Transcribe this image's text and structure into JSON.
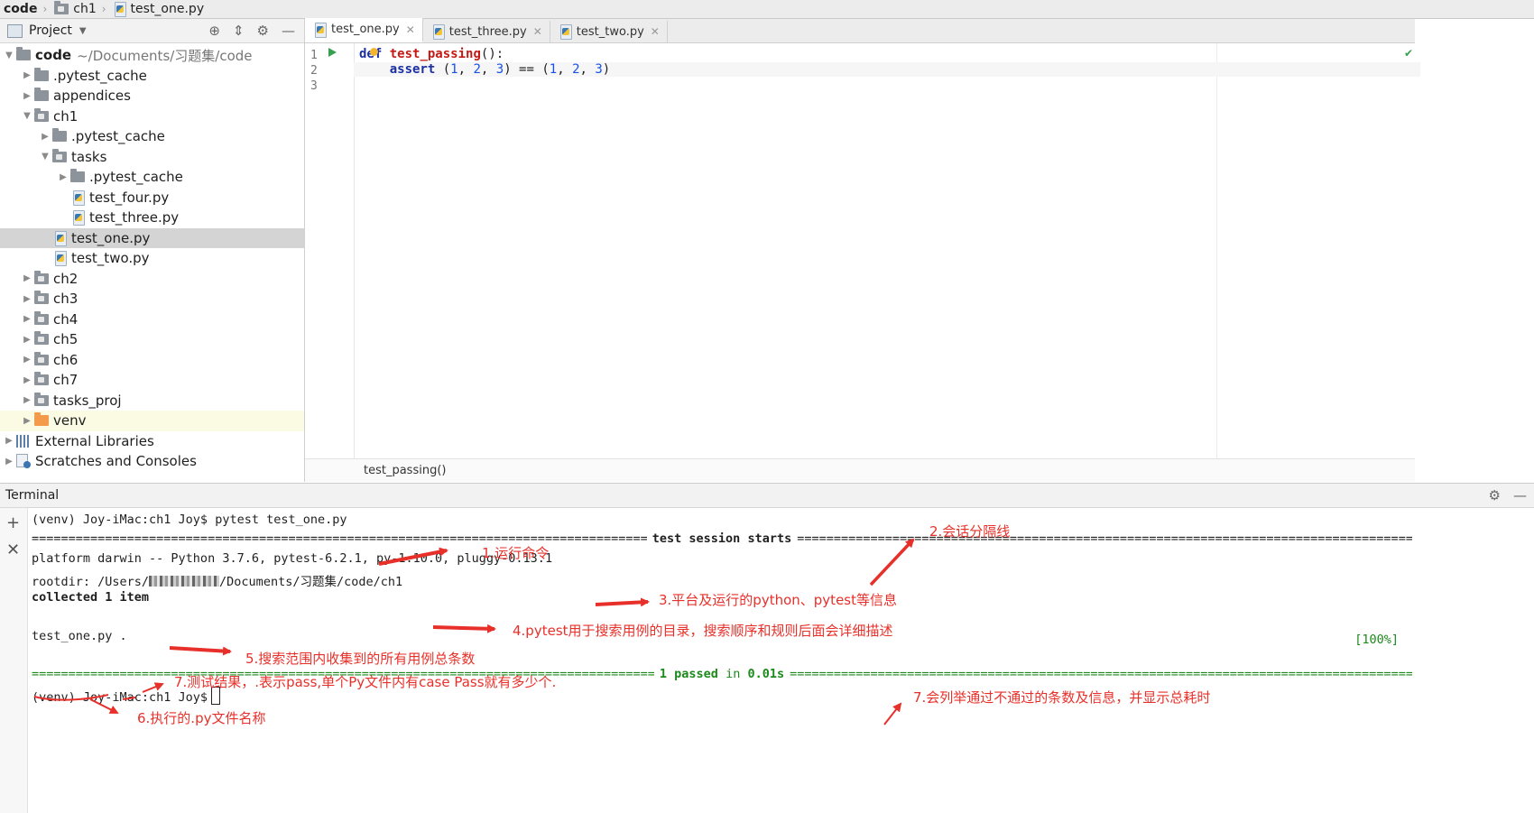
{
  "navbar": {
    "crumbs": [
      "code",
      "ch1",
      "test_one.py"
    ]
  },
  "project": {
    "title": "Project",
    "root_name": "code",
    "root_path": "~/Documents/习题集/code",
    "items": [
      ".pytest_cache",
      "appendices",
      "ch1",
      ".pytest_cache",
      "tasks",
      ".pytest_cache",
      "test_four.py",
      "test_three.py",
      "test_one.py",
      "test_two.py",
      "ch2",
      "ch3",
      "ch4",
      "ch5",
      "ch6",
      "ch7",
      "tasks_proj",
      "venv",
      "External Libraries",
      "Scratches and Consoles"
    ]
  },
  "editor": {
    "tabs": [
      "test_one.py",
      "test_three.py",
      "test_two.py"
    ],
    "line_numbers": [
      "1",
      "2",
      "3"
    ],
    "code": {
      "def_kw": "def",
      "fn_name": "test_passing",
      "fn_tail": "():",
      "assert_kw": "assert",
      "p1": " (",
      "n1": "1",
      "c1": ", ",
      "n2": "2",
      "c2": ", ",
      "n3": "3",
      "p2": ") == (",
      "n4": "1",
      "c3": ", ",
      "n5": "2",
      "c4": ", ",
      "n6": "3",
      "p3": ")"
    },
    "breadcrumb": "test_passing()"
  },
  "terminal": {
    "title": "Terminal",
    "cmd_line": "(venv) Joy-iMac:ch1 Joy$ pytest test_one.py",
    "session_label": "test session starts",
    "platform_line": "platform darwin -- Python 3.7.6, pytest-6.2.1, py-1.10.0, pluggy-0.13.1",
    "rootdir_prefix": "rootdir: /Users/",
    "rootdir_suffix": "/Documents/习题集/code/ch1",
    "collected_line": "collected 1 item",
    "result_file": "test_one.py",
    "result_dot": " .",
    "percent": "[100%]",
    "passed_count": "1 passed",
    "passed_in": " in ",
    "passed_time": "0.01s",
    "prompt_line": "(venv) Joy-iMac:ch1 Joy$"
  },
  "annotations": {
    "a1": "1.运行命令",
    "a2": "2.会话分隔线",
    "a3": "3.平台及运行的python、pytest等信息",
    "a4": "4.pytest用于搜索用例的目录，搜索顺序和规则后面会详细描述",
    "a5": "5.搜索范围内收集到的所有用例总条数",
    "a6": "6.执行的.py文件名称",
    "a7": "7.测试结果，.表示pass,单个Py文件内有case Pass就有多少个.",
    "a8": "7.会列举通过不通过的条数及信息，并显示总耗时"
  },
  "colors": {
    "annotation": "#e8302a",
    "pass_green": "#1b8a1b",
    "keyword_blue": "#1c2fa3",
    "function_red": "#c41a16"
  }
}
